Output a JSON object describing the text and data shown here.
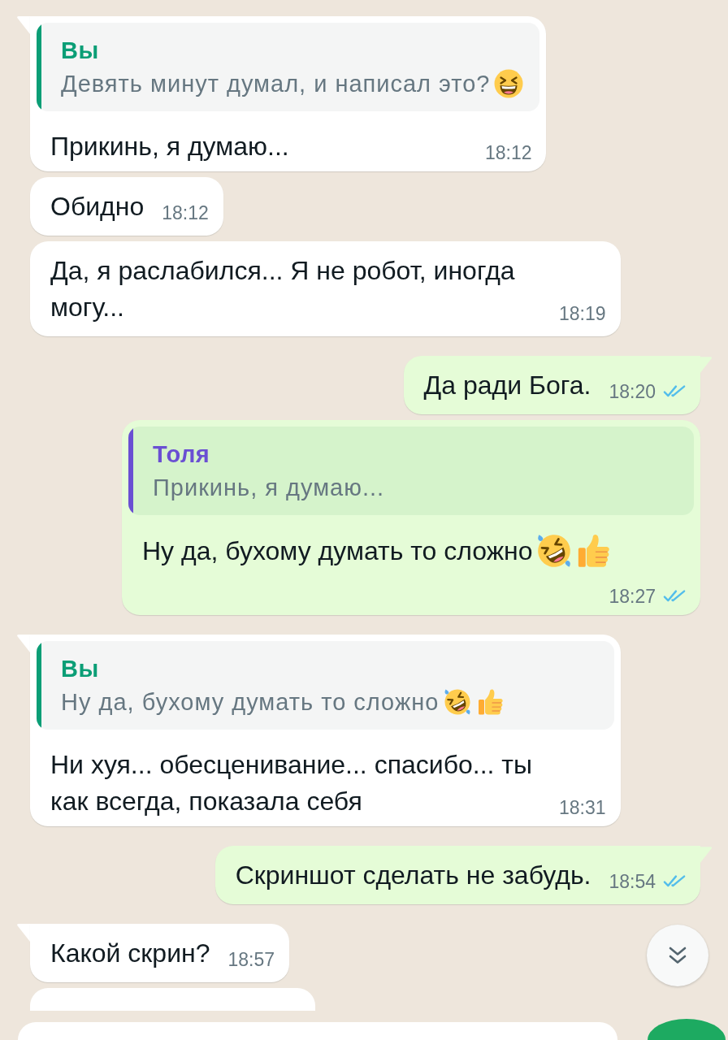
{
  "messages": [
    {
      "kind": "incoming",
      "tail": true,
      "reply": {
        "author": "Вы",
        "color": "#0b9e76",
        "text": "Девять минут думал, и написал это?",
        "emoji": [
          {
            "kind": "grinning-squinting"
          }
        ]
      },
      "text": "Прикинь, я думаю...",
      "time": "18:12"
    },
    {
      "kind": "incoming",
      "tail": false,
      "text": "Обидно",
      "time": "18:12"
    },
    {
      "kind": "incoming",
      "tail": false,
      "text": "Да, я раслабился... Я не робот, иногда могу...",
      "time": "18:19"
    },
    {
      "kind": "outgoing",
      "tail": true,
      "text": "Да ради Бога.",
      "time": "18:20",
      "read": true
    },
    {
      "kind": "outgoing",
      "tail": false,
      "reply": {
        "author": "Толя",
        "color": "#6a4fd3",
        "text": "Прикинь, я думаю..."
      },
      "text": "Ну да, бухому думать то сложно",
      "emoji": [
        {
          "kind": "rolling-laughing"
        },
        {
          "kind": "thumbs-up"
        }
      ],
      "time": "18:27",
      "read": true
    },
    {
      "kind": "incoming",
      "tail": true,
      "reply": {
        "author": "Вы",
        "color": "#0b9e76",
        "text": "Ну да, бухому думать то сложно",
        "emoji": [
          {
            "kind": "rolling-laughing"
          },
          {
            "kind": "thumbs-up"
          }
        ]
      },
      "text": "Ни хуя... обесценивание... спасибо... ты как всегда, показала себя",
      "time": "18:31"
    },
    {
      "kind": "outgoing",
      "tail": true,
      "text": "Скриншот сделать не забудь.",
      "time": "18:54",
      "read": true
    },
    {
      "kind": "incoming",
      "tail": true,
      "text": "Какой скрин?",
      "time": "18:57"
    },
    {
      "kind": "incoming",
      "tail": false,
      "partial": true
    }
  ]
}
